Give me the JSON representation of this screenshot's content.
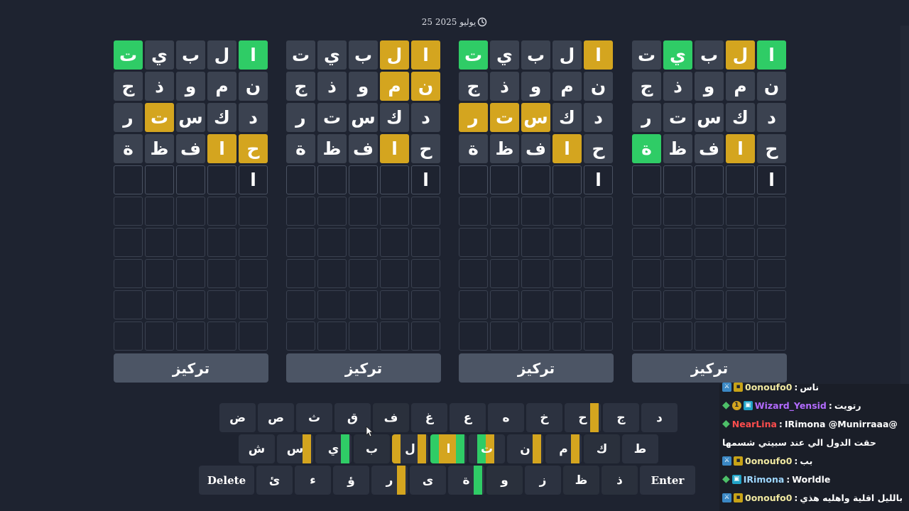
{
  "header": {
    "date": "25 يوليو 2025",
    "clock_icon": "clock-icon"
  },
  "boards": [
    {
      "rows": [
        {
          "letters": [
            "ت",
            "ي",
            "ب",
            "ل",
            "ا"
          ],
          "states": [
            "g",
            "b",
            "b",
            "b",
            "g"
          ]
        },
        {
          "letters": [
            "ج",
            "ذ",
            "و",
            "م",
            "ن"
          ],
          "states": [
            "b",
            "b",
            "b",
            "b",
            "b"
          ]
        },
        {
          "letters": [
            "ر",
            "ت",
            "س",
            "ك",
            "د"
          ],
          "states": [
            "b",
            "y",
            "b",
            "b",
            "b"
          ]
        },
        {
          "letters": [
            "ة",
            "ظ",
            "ف",
            "ا",
            "ح"
          ],
          "states": [
            "b",
            "b",
            "b",
            "y",
            "y"
          ]
        },
        {
          "letters": [
            "",
            "",
            "",
            "",
            "ا"
          ],
          "states": [
            "t",
            "t",
            "t",
            "t",
            "t"
          ]
        }
      ],
      "focus_label": "تركيز"
    },
    {
      "rows": [
        {
          "letters": [
            "ت",
            "ي",
            "ب",
            "ل",
            "ا"
          ],
          "states": [
            "b",
            "b",
            "b",
            "y",
            "y"
          ]
        },
        {
          "letters": [
            "ج",
            "ذ",
            "و",
            "م",
            "ن"
          ],
          "states": [
            "b",
            "b",
            "b",
            "y",
            "y"
          ]
        },
        {
          "letters": [
            "ر",
            "ت",
            "س",
            "ك",
            "د"
          ],
          "states": [
            "b",
            "b",
            "b",
            "b",
            "b"
          ]
        },
        {
          "letters": [
            "ة",
            "ظ",
            "ف",
            "ا",
            "ح"
          ],
          "states": [
            "b",
            "b",
            "b",
            "y",
            "b"
          ]
        },
        {
          "letters": [
            "",
            "",
            "",
            "",
            "ا"
          ],
          "states": [
            "t",
            "t",
            "t",
            "t",
            "t"
          ]
        }
      ],
      "focus_label": "تركيز"
    },
    {
      "rows": [
        {
          "letters": [
            "ت",
            "ي",
            "ب",
            "ل",
            "ا"
          ],
          "states": [
            "g",
            "b",
            "b",
            "b",
            "y"
          ]
        },
        {
          "letters": [
            "ج",
            "ذ",
            "و",
            "م",
            "ن"
          ],
          "states": [
            "b",
            "b",
            "b",
            "b",
            "b"
          ]
        },
        {
          "letters": [
            "ر",
            "ت",
            "س",
            "ك",
            "د"
          ],
          "states": [
            "y",
            "y",
            "y",
            "b",
            "b"
          ]
        },
        {
          "letters": [
            "ة",
            "ظ",
            "ف",
            "ا",
            "ح"
          ],
          "states": [
            "b",
            "b",
            "b",
            "y",
            "b"
          ]
        },
        {
          "letters": [
            "",
            "",
            "",
            "",
            "ا"
          ],
          "states": [
            "t",
            "t",
            "t",
            "t",
            "t"
          ]
        }
      ],
      "focus_label": "تركيز"
    },
    {
      "rows": [
        {
          "letters": [
            "ت",
            "ي",
            "ب",
            "ل",
            "ا"
          ],
          "states": [
            "b",
            "g",
            "b",
            "y",
            "g"
          ]
        },
        {
          "letters": [
            "ج",
            "ذ",
            "و",
            "م",
            "ن"
          ],
          "states": [
            "b",
            "b",
            "b",
            "b",
            "b"
          ]
        },
        {
          "letters": [
            "ر",
            "ت",
            "س",
            "ك",
            "د"
          ],
          "states": [
            "b",
            "b",
            "b",
            "b",
            "b"
          ]
        },
        {
          "letters": [
            "ة",
            "ظ",
            "ف",
            "ا",
            "ح"
          ],
          "states": [
            "g",
            "b",
            "b",
            "y",
            "b"
          ]
        },
        {
          "letters": [
            "",
            "",
            "",
            "",
            "ا"
          ],
          "states": [
            "t",
            "t",
            "t",
            "t",
            "t"
          ]
        }
      ],
      "focus_label": "تركيز"
    }
  ],
  "keyboard": {
    "row1": [
      {
        "k": "د",
        "bars": []
      },
      {
        "k": "ج",
        "bars": []
      },
      {
        "k": "ح",
        "bars": [
          "",
          "",
          "",
          "y"
        ]
      },
      {
        "k": "خ",
        "bars": []
      },
      {
        "k": "ه",
        "bars": []
      },
      {
        "k": "ع",
        "bars": []
      },
      {
        "k": "غ",
        "bars": []
      },
      {
        "k": "ف",
        "bars": [],
        "dim": true
      },
      {
        "k": "ق",
        "bars": []
      },
      {
        "k": "ث",
        "bars": []
      },
      {
        "k": "ص",
        "bars": []
      },
      {
        "k": "ض",
        "bars": []
      }
    ],
    "row2": [
      {
        "k": "ط",
        "bars": []
      },
      {
        "k": "ك",
        "bars": [],
        "dim": true
      },
      {
        "k": "م",
        "bars": [
          "",
          "",
          "",
          "y"
        ]
      },
      {
        "k": "ن",
        "bars": [
          "",
          "",
          "",
          "y"
        ]
      },
      {
        "k": "ت",
        "bars": [
          "",
          "g",
          "y",
          ""
        ]
      },
      {
        "k": "ا",
        "bars": [
          "g",
          "y",
          "y",
          "g"
        ]
      },
      {
        "k": "ل",
        "bars": [
          "y",
          "",
          "",
          "y"
        ]
      },
      {
        "k": "ب",
        "bars": [],
        "dim": true
      },
      {
        "k": "ي",
        "bars": [
          "",
          "",
          "",
          "g"
        ]
      },
      {
        "k": "س",
        "bars": [
          "",
          "",
          "",
          "y"
        ]
      },
      {
        "k": "ش",
        "bars": []
      }
    ],
    "row3": [
      {
        "k": "Enter",
        "wide": true
      },
      {
        "k": "ذ",
        "bars": [],
        "dim": true
      },
      {
        "k": "ظ",
        "bars": [],
        "dim": true
      },
      {
        "k": "ز",
        "bars": []
      },
      {
        "k": "و",
        "bars": [],
        "dim": true
      },
      {
        "k": "ة",
        "bars": [
          "",
          "",
          "",
          "g"
        ]
      },
      {
        "k": "ى",
        "bars": []
      },
      {
        "k": "ر",
        "bars": [
          "",
          "",
          "",
          "y"
        ]
      },
      {
        "k": "ؤ",
        "bars": []
      },
      {
        "k": "ء",
        "bars": []
      },
      {
        "k": "ئ",
        "bars": []
      },
      {
        "k": "Delete",
        "wide": true
      }
    ]
  },
  "chat": [
    {
      "badges": [
        "mod",
        "vip"
      ],
      "user": "0onoufo0",
      "color": "#f0e8a0",
      "msg": "ناس"
    },
    {
      "badges": [
        "chev",
        "num",
        "art"
      ],
      "user": "Wizard_Yensid",
      "color": "#b36bff",
      "msg": "رتويت"
    },
    {
      "badges": [
        "chev"
      ],
      "user": "NearLina",
      "color": "#ff4d4d",
      "msg": "@IRimona @Munirraaa"
    },
    {
      "badges": [],
      "user": "",
      "color": "#ffffff",
      "msg": "حقت الدول الي عند سبيتي شسمها"
    },
    {
      "badges": [
        "mod",
        "vip"
      ],
      "user": "0onoufo0",
      "color": "#f0e8a0",
      "msg": "بب"
    },
    {
      "badges": [
        "chev",
        "art"
      ],
      "user": "IRimona",
      "color": "#9ed7ff",
      "msg": "Worldle"
    },
    {
      "badges": [
        "mod",
        "vip"
      ],
      "user": "0onoufo0",
      "color": "#f0e8a0",
      "msg": "بالليل اقلية واهليه هذي"
    }
  ]
}
